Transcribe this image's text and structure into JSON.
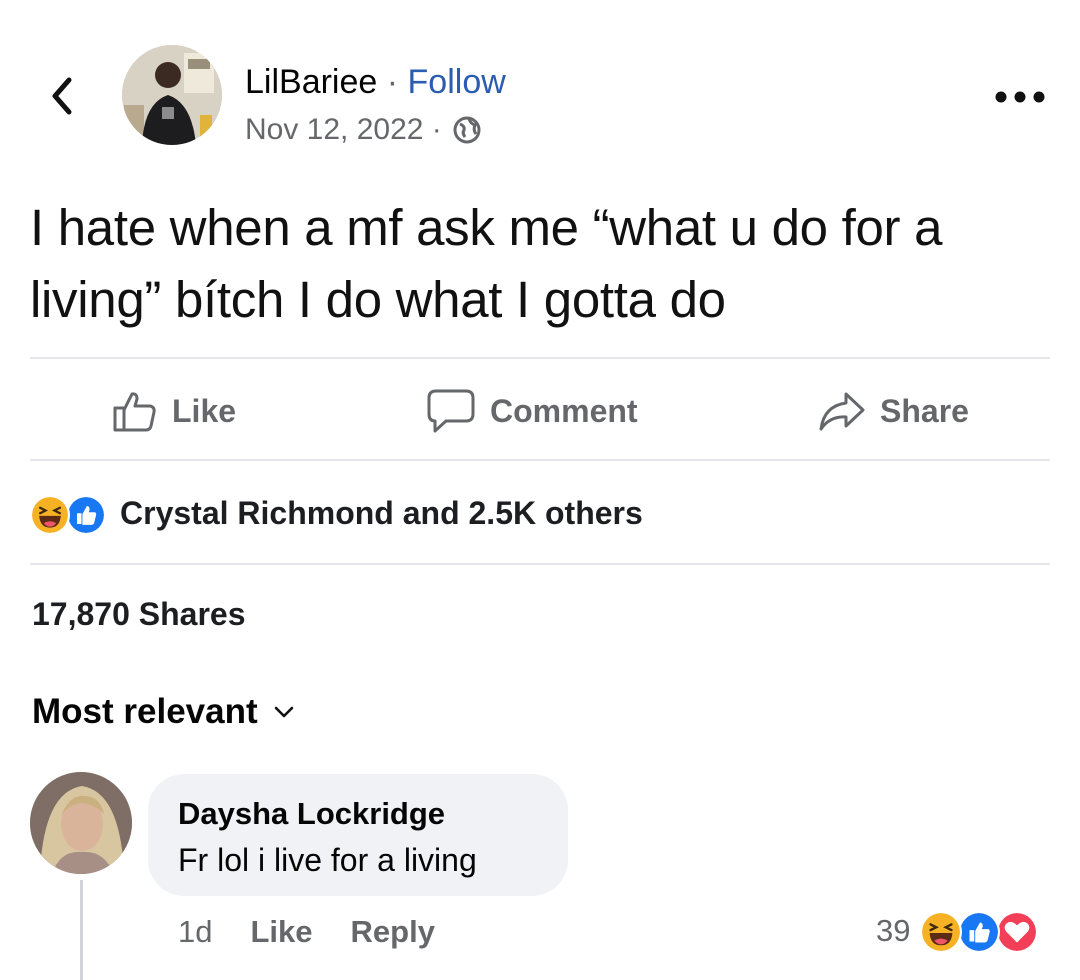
{
  "header": {
    "author": "LilBariee",
    "separator": " · ",
    "follow_label": "Follow",
    "date": "Nov 12, 2022 ·",
    "privacy_icon": "globe-icon",
    "more_icon": "more-dots-icon",
    "back_icon": "chevron-left-icon"
  },
  "post": {
    "text": "I hate when a mf ask me “what u do for a living” bítch I do what I gotta do"
  },
  "actions": [
    {
      "label": "Like",
      "icon": "thumbs-up-icon"
    },
    {
      "label": "Comment",
      "icon": "comment-icon"
    },
    {
      "label": "Share",
      "icon": "share-arrow-icon"
    }
  ],
  "reactions": {
    "icons": [
      "haha-reaction-icon",
      "like-reaction-icon"
    ],
    "summary": "Crystal Richmond and 2.5K others"
  },
  "shares": "17,870 Shares",
  "comments": {
    "sort_label": "Most relevant",
    "items": [
      {
        "author": "Daysha Lockridge",
        "text": "Fr lol i live for a living",
        "time": "1d",
        "like_label": "Like",
        "reply_label": "Reply",
        "reaction_count": "39",
        "reaction_icons": [
          "haha-reaction-icon",
          "like-reaction-icon",
          "love-reaction-icon"
        ]
      }
    ]
  },
  "colors": {
    "link": "#2a5db0",
    "muted": "#65676b",
    "bubble": "#f0f2f5",
    "like_blue": "#1877f2",
    "love_red": "#f33e58",
    "haha_yellow": "#f7b125"
  }
}
